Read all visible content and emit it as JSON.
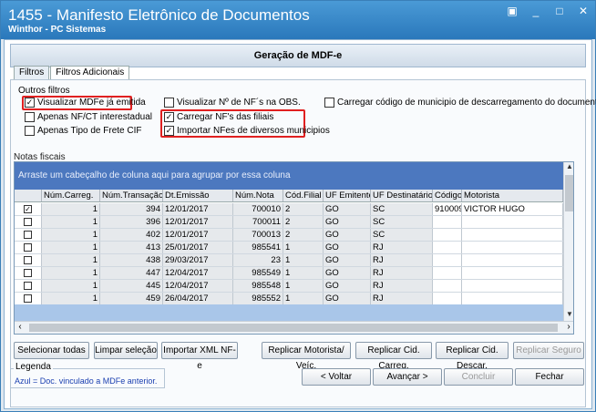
{
  "window": {
    "title": "1455 - Manifesto Eletrônico de Documentos",
    "subtitle": "Winthor - PC Sistemas"
  },
  "header": {
    "title": "Geração de MDF-e"
  },
  "tabs": [
    {
      "label": "Filtros",
      "active": false
    },
    {
      "label": "Filtros Adicionais",
      "active": true
    }
  ],
  "filters": {
    "group_title": "Outros filtros",
    "checkboxes": [
      {
        "label": "Visualizar MDFe já emitida",
        "checked": true
      },
      {
        "label": "Apenas NF/CT interestadual",
        "checked": false
      },
      {
        "label": "Apenas Tipo de Frete CIF",
        "checked": false
      },
      {
        "label": "Visualizar Nº de NF´s na OBS.",
        "checked": false
      },
      {
        "label": "Carregar NF's das filiais",
        "checked": true
      },
      {
        "label": "Importar NFes de diversos municipios",
        "checked": true
      },
      {
        "label": "Carregar código de municipio de descarregamento do documento",
        "checked": false
      }
    ]
  },
  "grid": {
    "section_label": "Notas fiscais",
    "group_hint": "Arraste um cabeçalho de coluna aqui para agrupar por essa coluna",
    "columns": [
      "",
      "Núm.Carreg.",
      "Núm.Transação",
      "Dt.Emissão",
      "Núm.Nota",
      "Cód.Filial",
      "UF Emitente",
      "UF Destinatário",
      "Código",
      "Motorista"
    ],
    "rows": [
      {
        "checked": true,
        "carreg": "1",
        "transacao": "394",
        "emissao": "12/01/2017",
        "nota": "700010",
        "filial": "2",
        "uf_emit": "GO",
        "uf_dest": "SC",
        "codigo": "910009",
        "motorista": "VICTOR HUGO"
      },
      {
        "checked": false,
        "carreg": "1",
        "transacao": "396",
        "emissao": "12/01/2017",
        "nota": "700011",
        "filial": "2",
        "uf_emit": "GO",
        "uf_dest": "SC",
        "codigo": "",
        "motorista": ""
      },
      {
        "checked": false,
        "carreg": "1",
        "transacao": "402",
        "emissao": "12/01/2017",
        "nota": "700013",
        "filial": "2",
        "uf_emit": "GO",
        "uf_dest": "SC",
        "codigo": "",
        "motorista": ""
      },
      {
        "checked": false,
        "carreg": "1",
        "transacao": "413",
        "emissao": "25/01/2017",
        "nota": "985541",
        "filial": "1",
        "uf_emit": "GO",
        "uf_dest": "RJ",
        "codigo": "",
        "motorista": ""
      },
      {
        "checked": false,
        "carreg": "1",
        "transacao": "438",
        "emissao": "29/03/2017",
        "nota": "23",
        "filial": "1",
        "uf_emit": "GO",
        "uf_dest": "RJ",
        "codigo": "",
        "motorista": ""
      },
      {
        "checked": false,
        "carreg": "1",
        "transacao": "447",
        "emissao": "12/04/2017",
        "nota": "985549",
        "filial": "1",
        "uf_emit": "GO",
        "uf_dest": "RJ",
        "codigo": "",
        "motorista": ""
      },
      {
        "checked": false,
        "carreg": "1",
        "transacao": "445",
        "emissao": "12/04/2017",
        "nota": "985548",
        "filial": "1",
        "uf_emit": "GO",
        "uf_dest": "RJ",
        "codigo": "",
        "motorista": ""
      },
      {
        "checked": false,
        "carreg": "1",
        "transacao": "459",
        "emissao": "26/04/2017",
        "nota": "985552",
        "filial": "1",
        "uf_emit": "GO",
        "uf_dest": "RJ",
        "codigo": "",
        "motorista": ""
      }
    ]
  },
  "actions": {
    "select_all": "Selecionar todas",
    "clear_selection": "Limpar seleção",
    "import_xml": "Importar XML NF-e",
    "replicate_driver": "Replicar Motorista/ Veíc.",
    "replicate_load_city": "Replicar Cid. Carreg.",
    "replicate_unload_city": "Replicar Cid. Descar.",
    "replicate_insurance": "Replicar Seguro"
  },
  "legend": {
    "title": "Legenda",
    "value": "Azul = Doc. vinculado a MDFe anterior."
  },
  "nav": {
    "back": "< Voltar",
    "next": "Avançar >",
    "finish": "Concluir",
    "close": "Fechar"
  },
  "colors": {
    "title_bar": "#2a78bb",
    "group_area": "#4c78bf",
    "highlight_frame": "#e02020"
  }
}
